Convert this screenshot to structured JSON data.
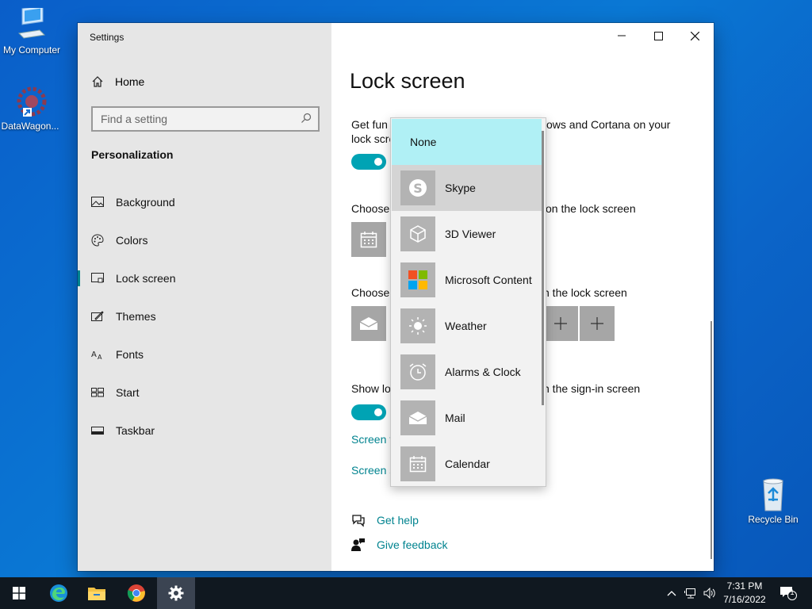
{
  "desktop": {
    "icons": [
      {
        "label": "My Computer"
      },
      {
        "label": "DataWagon..."
      },
      {
        "label": "Recycle Bin"
      }
    ]
  },
  "window": {
    "title": "Settings",
    "caption": {
      "minimize": "minimize-icon",
      "maximize": "maximize-icon",
      "close": "close-icon"
    }
  },
  "sidebar": {
    "home_label": "Home",
    "search_placeholder": "Find a setting",
    "section": "Personalization",
    "items": [
      {
        "label": "Background",
        "icon": "picture-icon"
      },
      {
        "label": "Colors",
        "icon": "palette-icon"
      },
      {
        "label": "Lock screen",
        "icon": "lock-screen-icon",
        "active": true
      },
      {
        "label": "Themes",
        "icon": "themes-icon"
      },
      {
        "label": "Fonts",
        "icon": "fonts-icon"
      },
      {
        "label": "Start",
        "icon": "start-icon"
      },
      {
        "label": "Taskbar",
        "icon": "taskbar-icon"
      }
    ]
  },
  "content": {
    "title": "Lock screen",
    "fun_facts_line1_left": "Get fun",
    "fun_facts_line1_right": "ows and Cortana on your",
    "fun_facts_line2": "lock scre",
    "choose_detailed_left": "Choose",
    "choose_detailed_right": "on the lock screen",
    "choose_quick_left": "Choose",
    "choose_quick_right": "n the lock screen",
    "show_bg_left": "Show lo",
    "show_bg_right": "n the sign-in screen",
    "screen_timeout_link": "Screen t",
    "screen_saver_link": "Screen s",
    "get_help": "Get help",
    "give_feedback": "Give feedback"
  },
  "dropdown": {
    "items": [
      {
        "label": "None"
      },
      {
        "label": "Skype",
        "icon": "skype-icon"
      },
      {
        "label": "3D Viewer",
        "icon": "cube-icon"
      },
      {
        "label": "Microsoft Content",
        "icon": "microsoft-logo-icon"
      },
      {
        "label": "Weather",
        "icon": "sun-icon"
      },
      {
        "label": "Alarms & Clock",
        "icon": "clock-icon"
      },
      {
        "label": "Mail",
        "icon": "mail-icon"
      },
      {
        "label": "Calendar",
        "icon": "calendar-icon"
      }
    ]
  },
  "taskbar": {
    "time": "7:31 PM",
    "date": "7/16/2022",
    "notification_count": "1"
  },
  "colors": {
    "accent": "#00a3b4",
    "link": "#00838f",
    "selected_item": "#b0f0f5"
  }
}
